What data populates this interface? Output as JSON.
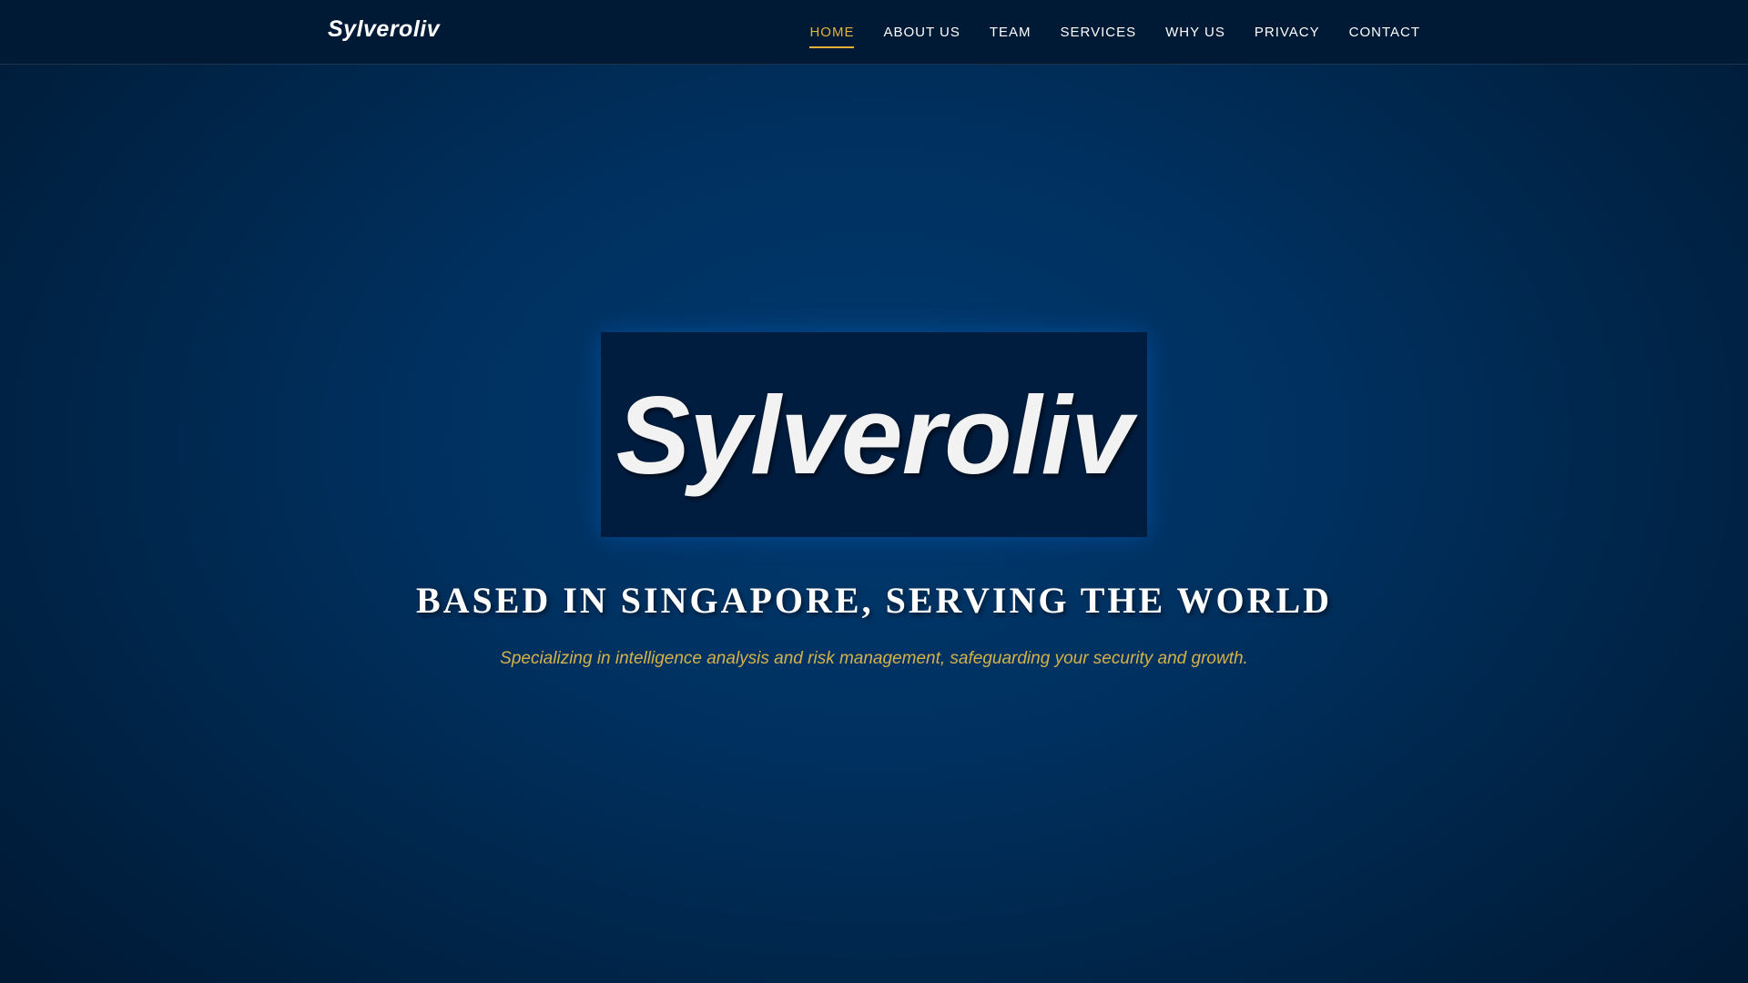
{
  "navbar": {
    "brand": "Sylveroliv",
    "links": [
      {
        "label": "HOME",
        "active": true
      },
      {
        "label": "ABOUT US",
        "active": false
      },
      {
        "label": "TEAM",
        "active": false
      },
      {
        "label": "SERVICES",
        "active": false
      },
      {
        "label": "WHY US",
        "active": false
      },
      {
        "label": "PRIVACY",
        "active": false
      },
      {
        "label": "CONTACT",
        "active": false
      }
    ]
  },
  "hero": {
    "logo_text": "Sylveroliv",
    "headline": "BASED IN SINGAPORE, SERVING THE WORLD",
    "tagline": "Specializing in intelligence analysis and risk management, safeguarding your security and growth."
  },
  "colors": {
    "accent": "#e3b23c",
    "background": "#002549",
    "navbar": "#001a36",
    "logo_box": "#001d40",
    "tagline": "#d4b24a"
  }
}
